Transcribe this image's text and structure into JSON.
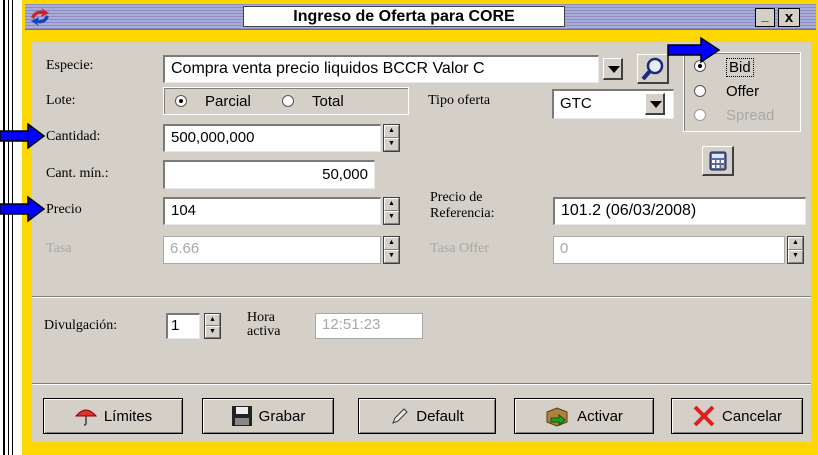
{
  "window": {
    "title": "Ingreso de Oferta para CORE",
    "minimize_label": "_",
    "close_label": "x"
  },
  "fields": {
    "especie": {
      "label": "Especie:",
      "value": "Compra venta precio liquidos BCCR Valor C"
    },
    "lote": {
      "label": "Lote:",
      "options": [
        "Parcial",
        "Total"
      ],
      "selected": "Parcial"
    },
    "tipo_oferta": {
      "label": "Tipo oferta",
      "value": "GTC"
    },
    "cantidad": {
      "label": "Cantidad:",
      "value": "500,000,000"
    },
    "cant_min": {
      "label": "Cant. mín.:",
      "value": "50,000"
    },
    "precio": {
      "label": "Precio",
      "value": "104"
    },
    "precio_referencia": {
      "label_line1": "Precio de",
      "label_line2": "Referencia:",
      "value": "101.2 (06/03/2008)"
    },
    "tasa": {
      "label": "Tasa",
      "value": "6.66"
    },
    "tasa_offer": {
      "label": "Tasa Offer",
      "value": "0"
    },
    "divulgacion": {
      "label": "Divulgación:",
      "value": "1"
    },
    "hora_activa": {
      "label_line1": "Hora",
      "label_line2": "activa",
      "value": "12:51:23"
    }
  },
  "side_radios": {
    "options": [
      {
        "label": "Bid",
        "selected": true,
        "enabled": true
      },
      {
        "label": "Offer",
        "selected": false,
        "enabled": true
      },
      {
        "label": "Spread",
        "selected": false,
        "enabled": false
      }
    ]
  },
  "buttons": {
    "limites": "Límites",
    "grabar": "Grabar",
    "default": "Default",
    "activar": "Activar",
    "cancelar": "Cancelar"
  },
  "icons": {
    "search": "magnifier-icon",
    "calculator": "calculator-icon",
    "app": "app-logo-icon"
  },
  "colors": {
    "title_bar": "#8a8cc4",
    "frame": "#ffd700",
    "panel": "#d4d0c8",
    "annotation_arrow": "#0000ff"
  }
}
